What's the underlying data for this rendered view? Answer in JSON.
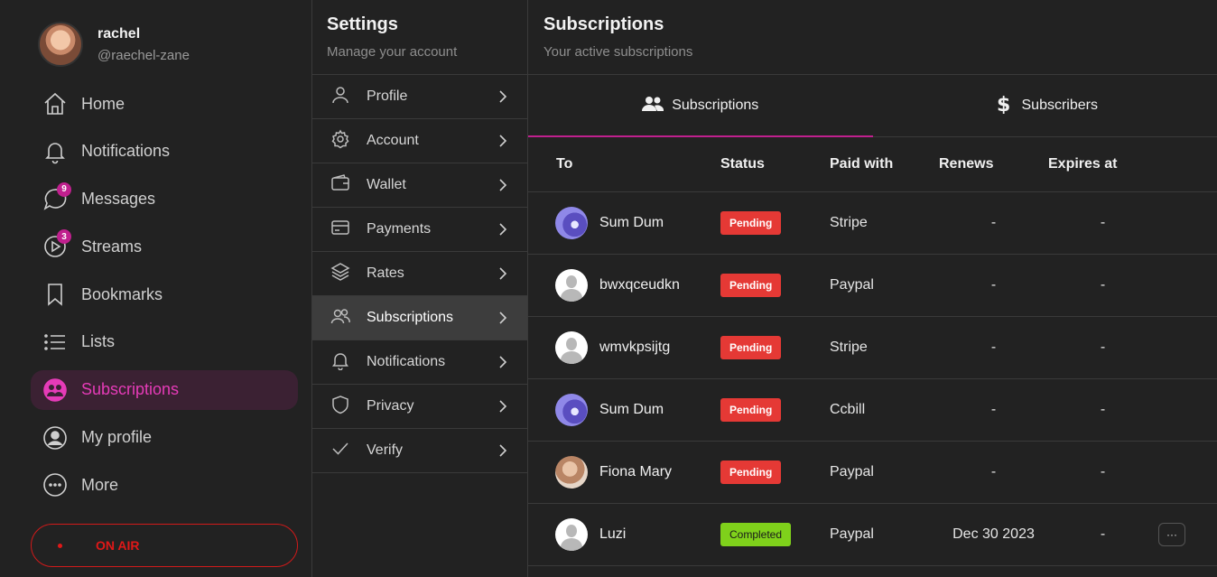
{
  "user": {
    "name": "rachel",
    "handle": "@raechel-zane"
  },
  "nav": {
    "items": [
      {
        "label": "Home",
        "icon": "home-icon"
      },
      {
        "label": "Notifications",
        "icon": "bell-icon"
      },
      {
        "label": "Messages",
        "icon": "chat-icon",
        "badge": "9"
      },
      {
        "label": "Streams",
        "icon": "play-icon",
        "badge": "3"
      },
      {
        "label": "Bookmarks",
        "icon": "bookmark-icon"
      },
      {
        "label": "Lists",
        "icon": "list-icon"
      },
      {
        "label": "Subscriptions",
        "icon": "subscriptions-icon",
        "active": true
      },
      {
        "label": "My profile",
        "icon": "user-circle-icon"
      },
      {
        "label": "More",
        "icon": "more-icon"
      }
    ],
    "on_air": "ON AIR"
  },
  "settings": {
    "title": "Settings",
    "subtitle": "Manage your account",
    "items": [
      {
        "label": "Profile",
        "icon": "user-icon"
      },
      {
        "label": "Account",
        "icon": "gear-icon"
      },
      {
        "label": "Wallet",
        "icon": "wallet-icon"
      },
      {
        "label": "Payments",
        "icon": "credit-card-icon"
      },
      {
        "label": "Rates",
        "icon": "layers-icon"
      },
      {
        "label": "Subscriptions",
        "icon": "users-icon",
        "active": true
      },
      {
        "label": "Notifications",
        "icon": "bell-icon"
      },
      {
        "label": "Privacy",
        "icon": "shield-icon"
      },
      {
        "label": "Verify",
        "icon": "check-icon"
      }
    ]
  },
  "main": {
    "title": "Subscriptions",
    "subtitle": "Your active subscriptions",
    "tabs": [
      {
        "label": "Subscriptions",
        "icon": "users-icon",
        "active": true
      },
      {
        "label": "Subscribers",
        "icon": "dollar-icon"
      }
    ],
    "columns": [
      "To",
      "Status",
      "Paid with",
      "Renews",
      "Expires at"
    ],
    "rows": [
      {
        "name": "Sum Dum",
        "avatar": "purple",
        "status": "Pending",
        "paid_with": "Stripe",
        "renews": "-",
        "expires": "-"
      },
      {
        "name": "bwxqceudkn",
        "avatar": "default",
        "status": "Pending",
        "paid_with": "Paypal",
        "renews": "-",
        "expires": "-"
      },
      {
        "name": "wmvkpsijtg",
        "avatar": "default",
        "status": "Pending",
        "paid_with": "Stripe",
        "renews": "-",
        "expires": "-"
      },
      {
        "name": "Sum Dum",
        "avatar": "purple",
        "status": "Pending",
        "paid_with": "Ccbill",
        "renews": "-",
        "expires": "-"
      },
      {
        "name": "Fiona Mary",
        "avatar": "photo",
        "status": "Pending",
        "paid_with": "Paypal",
        "renews": "-",
        "expires": "-"
      },
      {
        "name": "Luzi",
        "avatar": "default",
        "status": "Completed",
        "paid_with": "Paypal",
        "renews": "Dec 30 2023",
        "expires": "-",
        "more": "···"
      }
    ]
  },
  "colors": {
    "accent": "#c0208e",
    "pending": "#e53935",
    "completed": "#7fd11b",
    "on_air": "#e01818"
  }
}
